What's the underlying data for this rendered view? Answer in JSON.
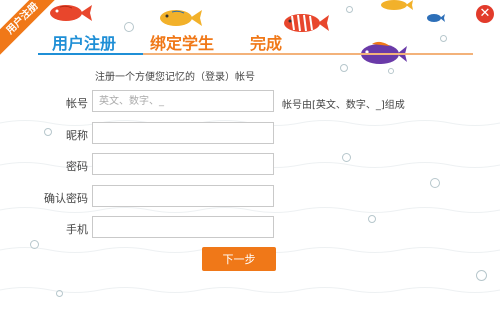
{
  "ribbon": {
    "label": "用户注册"
  },
  "tabs": [
    {
      "label": "用户注册"
    },
    {
      "label": "绑定学生"
    },
    {
      "label": "完成"
    }
  ],
  "intro_text": "注册一个方便您记忆的（登录）帐号",
  "form": {
    "account": {
      "label": "帐号",
      "placeholder": "英文、数字、_",
      "hint": "帐号由[英文、数字、_]组成"
    },
    "nickname": {
      "label": "昵称"
    },
    "password": {
      "label": "密码"
    },
    "confirm": {
      "label": "确认密码"
    },
    "phone": {
      "label": "手机"
    }
  },
  "next_button": "下一步",
  "close_glyph": "✕",
  "colors": {
    "accent_orange": "#f07818",
    "accent_blue": "#1f8fd6",
    "close_red": "#e23b2b"
  },
  "icons": [
    "close-icon",
    "fish-icon",
    "bubble-icon"
  ]
}
